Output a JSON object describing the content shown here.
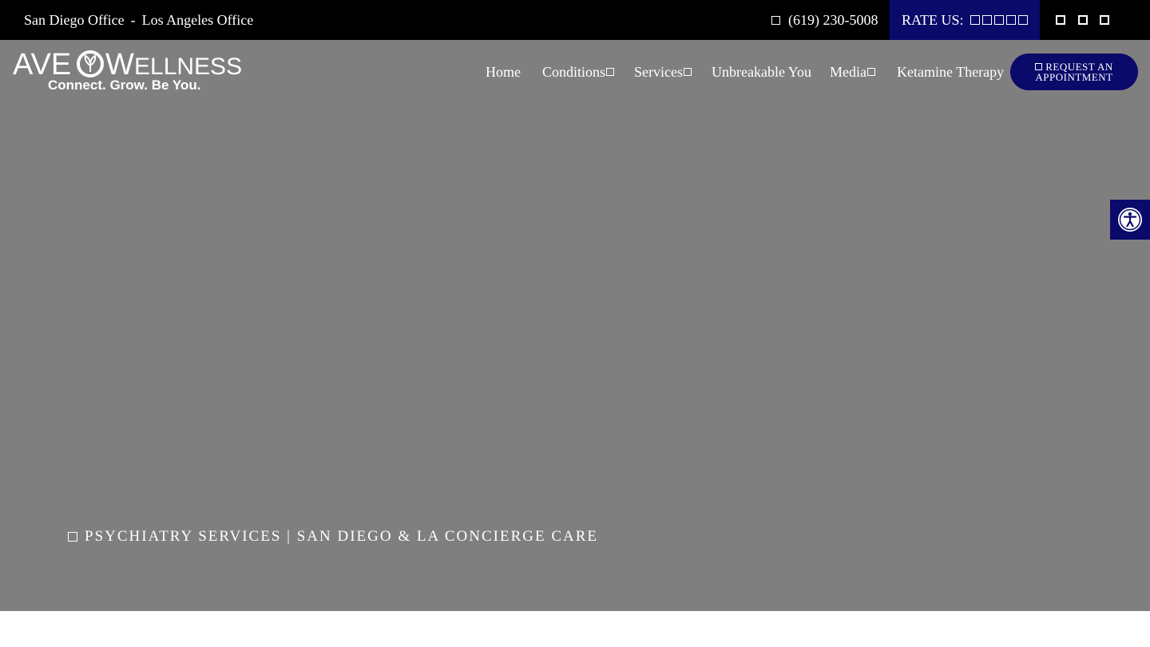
{
  "topbar": {
    "offices": [
      "San Diego Office",
      "Los Angeles Office"
    ],
    "separator": "-",
    "phone": "(619) 230-5008",
    "phone_icon": "phone-icon",
    "rate_label": "RATE US:",
    "rating_icons": [
      "star-icon",
      "star-icon",
      "star-icon",
      "star-icon",
      "star-icon"
    ],
    "social_icons": [
      "facebook-icon",
      "instagram-icon",
      "linkedin-icon"
    ]
  },
  "brand": {
    "name": "AVEO WELLNESS",
    "tagline": "Connect. Grow. Be You."
  },
  "nav": {
    "items": [
      {
        "label": "Home",
        "dropdown": false
      },
      {
        "label": "Conditions",
        "dropdown": true
      },
      {
        "label": "Services",
        "dropdown": true
      },
      {
        "label": "Unbreakable You",
        "dropdown": false
      },
      {
        "label": "Media",
        "dropdown": true
      },
      {
        "label": "Ketamine Therapy",
        "dropdown": false
      }
    ],
    "cta_line1": "REQUEST AN",
    "cta_line2": "APPOINTMENT",
    "cta_icon": "calendar-icon"
  },
  "accessibility": {
    "icon": "accessibility-icon"
  },
  "hero": {
    "caption": "PSYCHIATRY SERVICES | SAN DIEGO & LA CONCIERGE CARE",
    "caption_icon": "location-icon"
  },
  "colors": {
    "topbar_bg": "#000000",
    "accent_navy": "#0a0a6b",
    "hero_bg": "#7f7f7f",
    "text": "#ffffff"
  }
}
